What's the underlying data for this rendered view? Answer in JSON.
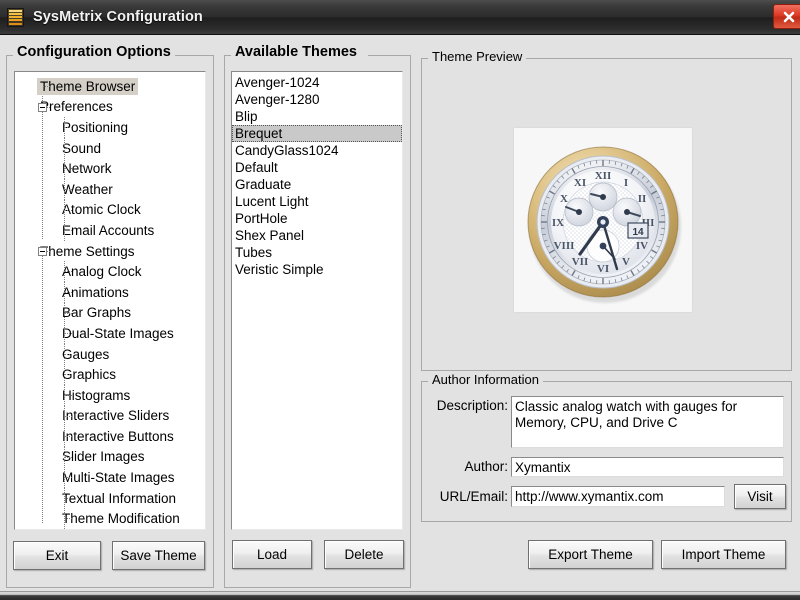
{
  "window": {
    "title": "SysMetrix Configuration",
    "icon": "bargraph-icon",
    "close_label": "×"
  },
  "config_options": {
    "title": "Configuration Options",
    "tree": [
      {
        "label": "Theme Browser",
        "level": 0,
        "expander": false,
        "selected": true
      },
      {
        "label": "Preferences",
        "level": 0,
        "expander": true,
        "selected": false
      },
      {
        "label": "Positioning",
        "level": 1,
        "expander": false,
        "selected": false
      },
      {
        "label": "Sound",
        "level": 1,
        "expander": false,
        "selected": false
      },
      {
        "label": "Network",
        "level": 1,
        "expander": false,
        "selected": false
      },
      {
        "label": "Weather",
        "level": 1,
        "expander": false,
        "selected": false
      },
      {
        "label": "Atomic Clock",
        "level": 1,
        "expander": false,
        "selected": false
      },
      {
        "label": "Email Accounts",
        "level": 1,
        "expander": false,
        "selected": false
      },
      {
        "label": "Theme Settings",
        "level": 0,
        "expander": true,
        "selected": false
      },
      {
        "label": "Analog Clock",
        "level": 1,
        "expander": false,
        "selected": false
      },
      {
        "label": "Animations",
        "level": 1,
        "expander": false,
        "selected": false
      },
      {
        "label": "Bar Graphs",
        "level": 1,
        "expander": false,
        "selected": false
      },
      {
        "label": "Dual-State Images",
        "level": 1,
        "expander": false,
        "selected": false
      },
      {
        "label": "Gauges",
        "level": 1,
        "expander": false,
        "selected": false
      },
      {
        "label": "Graphics",
        "level": 1,
        "expander": false,
        "selected": false
      },
      {
        "label": "Histograms",
        "level": 1,
        "expander": false,
        "selected": false
      },
      {
        "label": "Interactive Sliders",
        "level": 1,
        "expander": false,
        "selected": false
      },
      {
        "label": "Interactive Buttons",
        "level": 1,
        "expander": false,
        "selected": false
      },
      {
        "label": "Slider Images",
        "level": 1,
        "expander": false,
        "selected": false
      },
      {
        "label": "Multi-State Images",
        "level": 1,
        "expander": false,
        "selected": false
      },
      {
        "label": "Textual Information",
        "level": 1,
        "expander": false,
        "selected": false
      },
      {
        "label": "Theme Modification",
        "level": 1,
        "expander": false,
        "selected": false
      }
    ],
    "exit_label": "Exit",
    "save_theme_label": "Save Theme"
  },
  "available_themes": {
    "title": "Available Themes",
    "items": [
      {
        "label": "Avenger-1024",
        "selected": false
      },
      {
        "label": "Avenger-1280",
        "selected": false
      },
      {
        "label": "Blip",
        "selected": false
      },
      {
        "label": "Brequet",
        "selected": true
      },
      {
        "label": "CandyGlass1024",
        "selected": false
      },
      {
        "label": "Default",
        "selected": false
      },
      {
        "label": "Graduate",
        "selected": false
      },
      {
        "label": "Lucent Light",
        "selected": false
      },
      {
        "label": "PortHole",
        "selected": false
      },
      {
        "label": "Shex Panel",
        "selected": false
      },
      {
        "label": "Tubes",
        "selected": false
      },
      {
        "label": "Veristic Simple",
        "selected": false
      }
    ],
    "load_label": "Load",
    "delete_label": "Delete"
  },
  "theme_preview": {
    "title": "Theme Preview",
    "image_alt": "analog-watch-preview",
    "date_window_value": "14"
  },
  "author_information": {
    "title": "Author Information",
    "description_label": "Description:",
    "description_value": "Classic analog watch with gauges for Memory, CPU, and Drive C",
    "author_label": "Author:",
    "author_value": "Xymantix",
    "url_label": "URL/Email:",
    "url_value": "http://www.xymantix.com",
    "visit_label": "Visit"
  },
  "actions": {
    "export_theme_label": "Export Theme",
    "import_theme_label": "Import Theme"
  },
  "colors": {
    "dialog_bg": "#e2e2e2",
    "titlebar": "#2b2b2b",
    "close_red": "#dc3a23",
    "selection_gray": "#c9c9c9",
    "tree_selection": "#d4d0c8"
  }
}
